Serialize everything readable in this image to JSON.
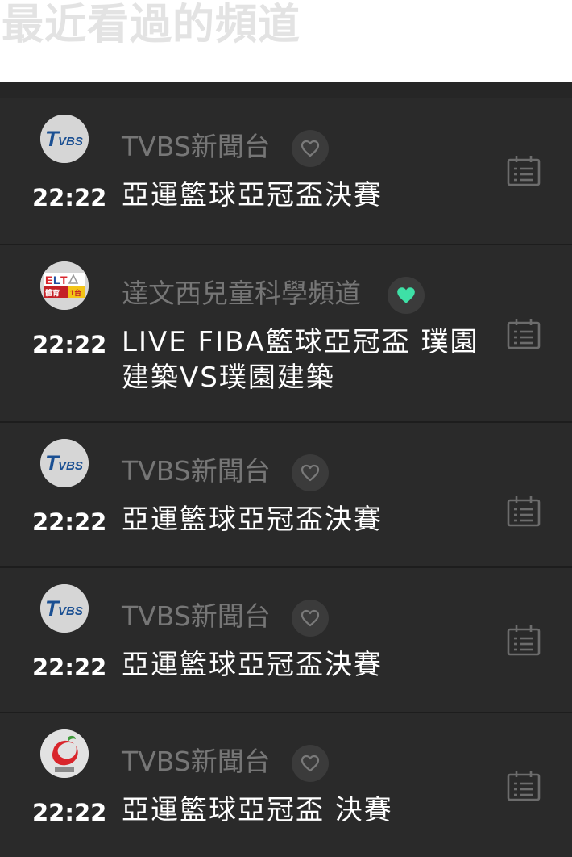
{
  "header": {
    "title": "最近看過的頻道"
  },
  "rows": [
    {
      "channel": "TVBS新聞台",
      "logo": "tvbs-logo",
      "favorited": false,
      "time": "22:22",
      "program": "亞運籃球亞冠盃決賽"
    },
    {
      "channel": "達文西兒童科學頻道",
      "logo": "elta-sports-1-logo",
      "favorited": true,
      "time": "22:22",
      "program": "LIVE FIBA籃球亞冠盃 璞園建築VS璞園建築"
    },
    {
      "channel": "TVBS新聞台",
      "logo": "tvbs-logo",
      "favorited": false,
      "time": "22:22",
      "program": "亞運籃球亞冠盃決賽"
    },
    {
      "channel": "TVBS新聞台",
      "logo": "tvbs-logo",
      "favorited": false,
      "time": "22:22",
      "program": "亞運籃球亞冠盃決賽"
    },
    {
      "channel": "TVBS新聞台",
      "logo": "red-swirl-logo",
      "favorited": false,
      "time": "22:22",
      "program": "亞運籃球亞冠盃 決賽"
    }
  ],
  "colors": {
    "background": "#2a2a2a",
    "favorite_active": "#3ee0a6",
    "muted_text": "#767676",
    "header_text": "#e3e3e3"
  },
  "icons": {
    "favorite": "heart-icon",
    "schedule": "calendar-list-icon"
  }
}
